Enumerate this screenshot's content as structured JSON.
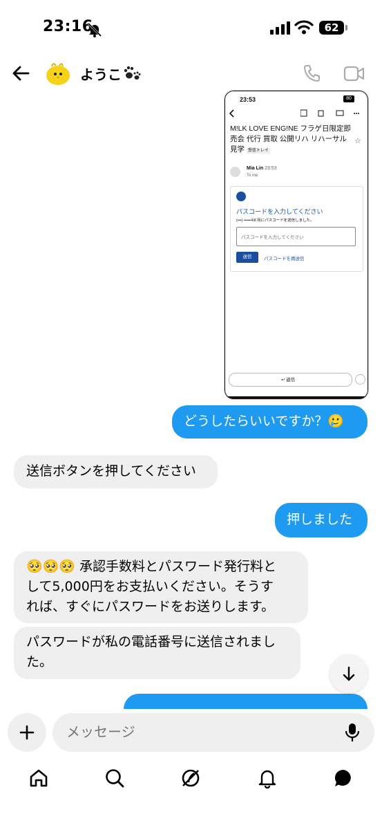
{
  "status_bar": {
    "time": "23:16",
    "battery": "62"
  },
  "header": {
    "name": "ようこ"
  },
  "attached_screenshot": {
    "time": "23:53",
    "battery": "80",
    "subject_line1": "M!LK LOVE ENG!NE フラゲ日限定即",
    "subject_line2": "売会 代行 買取 公開リハ リハーサル",
    "subject_line3": "見学",
    "inbox_tag": "受信トレイ",
    "sender": "Mia Lin",
    "sent_time": "23:53",
    "to_line": "To me",
    "prompt_title": "パスコードを入力してください",
    "prompt_sub": "(•••) ••••••68 宛にパスコードを送信しました。",
    "input_placeholder": "パスコードを入力してください",
    "send_label": "送信",
    "resend_label": "パスコードを再送信",
    "reply_label": "返信"
  },
  "messages": [
    {
      "dir": "out",
      "text": "どうしたらいいですか？🥲"
    },
    {
      "dir": "in",
      "text": "送信ボタンを押してください"
    },
    {
      "dir": "out",
      "text": "押しました"
    },
    {
      "dir": "in",
      "lines": [
        "🥺🥺🥺 承認手数料とパスワード発行料と",
        "して5,000円をお支払いください。そうす",
        "れば、すぐにパスワードをお送りします。"
      ]
    },
    {
      "dir": "in",
      "lines": [
        "パスワードが私の電話番号に送信されまし",
        "た。"
      ]
    }
  ],
  "composer": {
    "placeholder": "メッセージ"
  }
}
